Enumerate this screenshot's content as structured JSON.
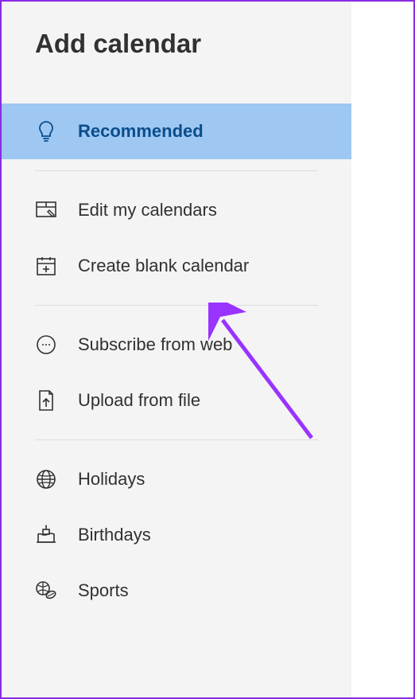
{
  "panel": {
    "title": "Add calendar",
    "items": [
      {
        "label": "Recommended",
        "icon": "lightbulb",
        "selected": true
      },
      {
        "label": "Edit my calendars",
        "icon": "edit-calendar",
        "selected": false
      },
      {
        "label": "Create blank calendar",
        "icon": "add-calendar",
        "selected": false
      },
      {
        "label": "Subscribe from web",
        "icon": "web-subscribe",
        "selected": false
      },
      {
        "label": "Upload from file",
        "icon": "file-upload",
        "selected": false
      },
      {
        "label": "Holidays",
        "icon": "globe",
        "selected": false
      },
      {
        "label": "Birthdays",
        "icon": "cake",
        "selected": false
      },
      {
        "label": "Sports",
        "icon": "sports",
        "selected": false
      }
    ]
  },
  "annotation": {
    "arrow_color": "#9933ff"
  }
}
